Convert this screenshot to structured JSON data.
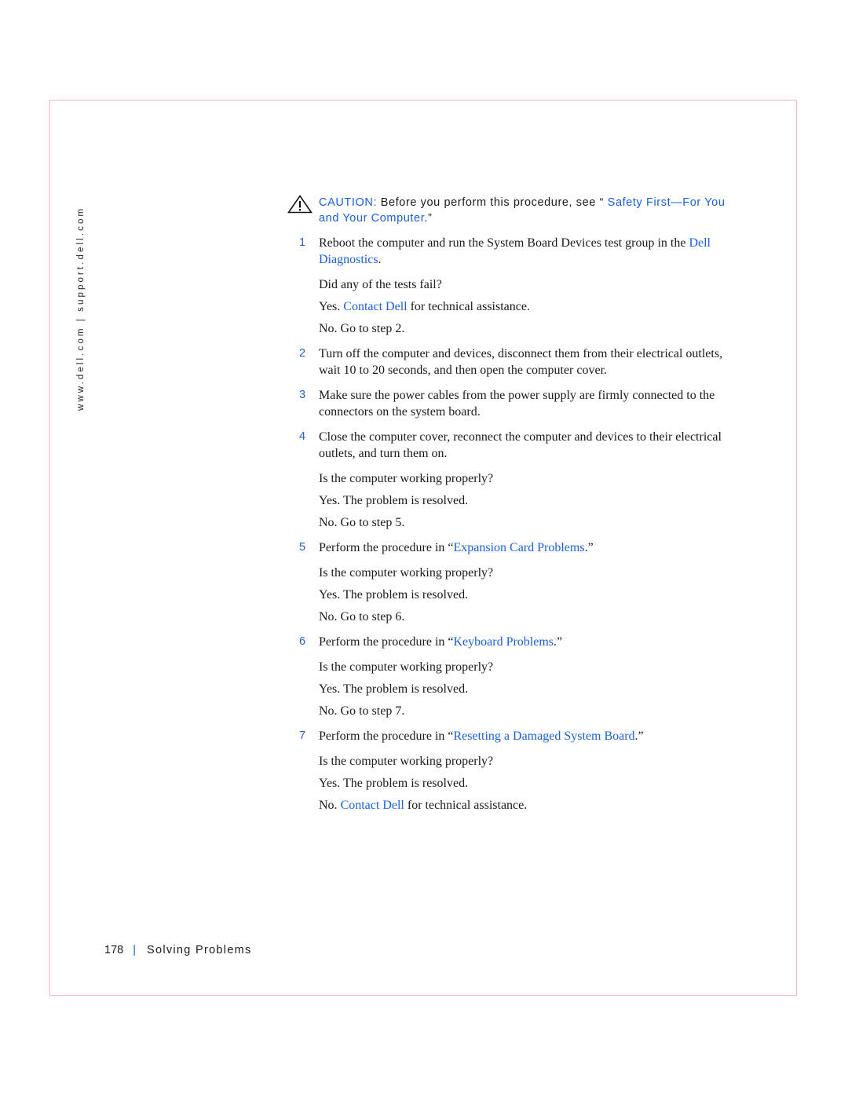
{
  "side_url": "www.dell.com | support.dell.com",
  "caution": {
    "label": "CAUTION:",
    "text": " Before you perform this procedure, see “ ",
    "link": "Safety First—For You and Your Computer",
    "after": ".”"
  },
  "steps": [
    {
      "num": "1",
      "pre": "Reboot the computer and run the System Board Devices test group in the ",
      "link": "Dell Diagnostics",
      "post": ".",
      "paras": [
        {
          "pre": "Did any of the tests fail?"
        },
        {
          "pre": "Yes. ",
          "link": "Contact Dell",
          "post": " for technical assistance."
        },
        {
          "pre": "No. Go to step 2."
        }
      ]
    },
    {
      "num": "2",
      "pre": "Turn off the computer and devices, disconnect them from their electrical outlets, wait 10 to 20 seconds, and then open the computer cover.",
      "paras": []
    },
    {
      "num": "3",
      "pre": "Make sure the power cables from the power supply are firmly connected to the connectors on the system board.",
      "paras": []
    },
    {
      "num": "4",
      "pre": "Close the computer cover, reconnect the computer and devices to their electrical outlets, and turn them on.",
      "paras": [
        {
          "pre": "Is the computer working properly?"
        },
        {
          "pre": "Yes. The problem is resolved."
        },
        {
          "pre": "No. Go to step 5."
        }
      ]
    },
    {
      "num": "5",
      "pre": "Perform the procedure in “",
      "link": "Expansion Card Problems",
      "post": ".”",
      "paras": [
        {
          "pre": "Is the computer working properly?"
        },
        {
          "pre": "Yes. The problem is resolved."
        },
        {
          "pre": "No. Go to step 6."
        }
      ]
    },
    {
      "num": "6",
      "pre": "Perform the procedure in “",
      "link": "Keyboard Problems",
      "post": ".”",
      "paras": [
        {
          "pre": "Is the computer working properly?"
        },
        {
          "pre": "Yes. The problem is resolved."
        },
        {
          "pre": "No. Go to step 7."
        }
      ]
    },
    {
      "num": "7",
      "pre": "Perform the procedure in “",
      "link": "Resetting a Damaged System Board",
      "post": ".”",
      "paras": [
        {
          "pre": "Is the computer working properly?"
        },
        {
          "pre": "Yes. The problem is resolved."
        },
        {
          "pre": "No. ",
          "link": "Contact Dell",
          "post": " for technical assistance."
        }
      ]
    }
  ],
  "footer": {
    "page_number": "178",
    "separator": "|",
    "section_title": "Solving Problems"
  }
}
